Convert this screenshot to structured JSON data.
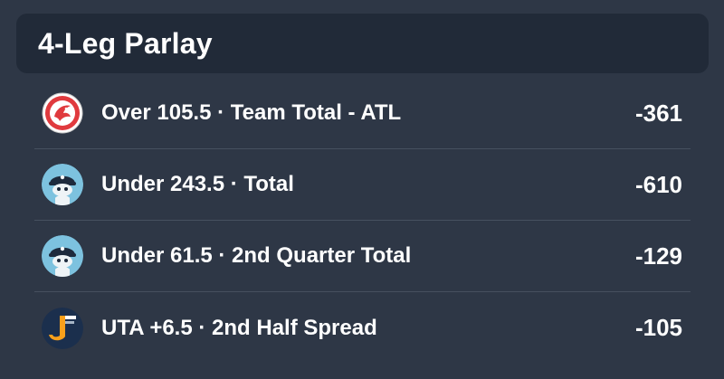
{
  "header": {
    "title": "4-Leg Parlay"
  },
  "legs": [
    {
      "description": "Over 105.5 · Team Total - ATL",
      "odds": "-361",
      "icon": "hawks-logo-icon"
    },
    {
      "description": "Under 243.5 · Total",
      "odds": "-610",
      "icon": "bot-avatar-icon"
    },
    {
      "description": "Under 61.5 · 2nd Quarter Total",
      "odds": "-129",
      "icon": "bot-avatar-icon"
    },
    {
      "description": "UTA +6.5 · 2nd Half Spread",
      "odds": "-105",
      "icon": "jazz-logo-icon"
    }
  ],
  "colors": {
    "background": "#2e3746",
    "header_background": "#212a38",
    "divider": "#46505f",
    "hawks_red": "#e03a3e",
    "bot_blue": "#7dc2df",
    "jazz_navy": "#1b2f4d",
    "jazz_gold": "#f9a01b"
  }
}
